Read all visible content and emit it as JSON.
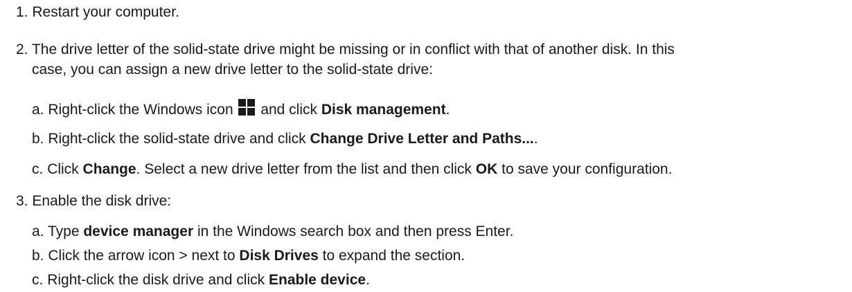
{
  "steps": [
    {
      "number": "1.",
      "text": "Restart your computer."
    },
    {
      "number": "2.",
      "text_line1": "The drive letter of the solid-state drive might be missing or in conflict with that of another disk. In this",
      "text_line2": "case, you can assign a new drive letter to the solid-state drive:",
      "substeps": [
        {
          "letter": "a.",
          "pre": "Right-click the Windows icon",
          "icon": "windows-icon",
          "mid": "and click",
          "bold": "Disk management",
          "post": "."
        },
        {
          "letter": "b.",
          "pre": "Right-click the solid-state drive and click",
          "bold": "Change Drive Letter and Paths...",
          "post": "."
        },
        {
          "letter": "c.",
          "pre": "Click",
          "bold": "Change",
          "mid": ". Select a new drive letter from the list and then click",
          "bold2": "OK",
          "post": "to save your configuration."
        }
      ]
    },
    {
      "number": "3.",
      "text": "Enable the disk drive:",
      "substeps": [
        {
          "letter": "a.",
          "pre": "Type",
          "bold": "device manager",
          "post": "in the Windows search box and then press Enter."
        },
        {
          "letter": "b.",
          "pre": "Click the arrow icon > next to",
          "bold": "Disk Drives",
          "post": "to expand the section."
        },
        {
          "letter": "c.",
          "pre": "Right-click the disk drive and click",
          "bold": "Enable device",
          "post": "."
        }
      ]
    }
  ]
}
